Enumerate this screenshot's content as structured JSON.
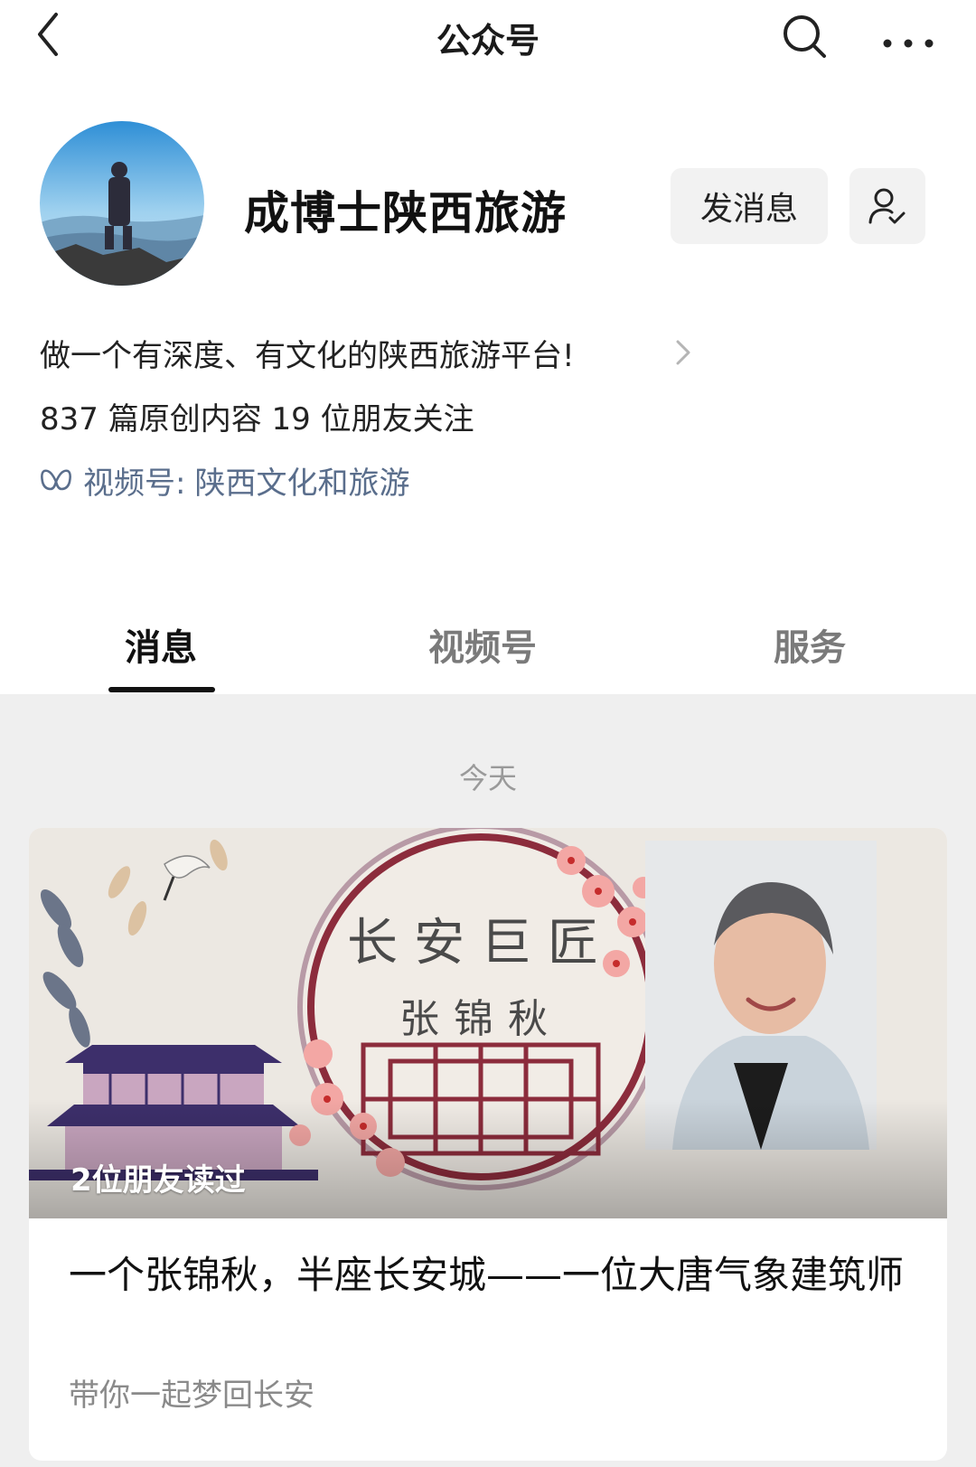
{
  "topbar": {
    "title": "公众号"
  },
  "account": {
    "name": "成博士陕西旅游",
    "message_button": "发消息",
    "description": "做一个有深度、有文化的陕西旅游平台!",
    "stats": "837 篇原创内容  19 位朋友关注",
    "channel_label": "视频号:",
    "channel_name": "陕西文化和旅游"
  },
  "tabs": [
    {
      "label": "消息",
      "active": true
    },
    {
      "label": "视频号",
      "active": false
    },
    {
      "label": "服务",
      "active": false
    }
  ],
  "feed": {
    "date_label": "今天",
    "article": {
      "cover_title": "长安巨匠",
      "cover_name": "张锦秋",
      "read_badge": "2位朋友读过",
      "title": "一个张锦秋，半座长安城——一位大唐气象建筑师",
      "subtitle": "带你一起梦回长安"
    }
  },
  "colors": {
    "accent_link": "#5a6e8c",
    "active_tab": "#111111",
    "inactive_tab": "#7a7a7a",
    "feed_bg": "#efefef"
  },
  "icons": [
    "back-arrow-icon",
    "search-icon",
    "more-icon",
    "follow-user-icon",
    "chevron-right-icon",
    "channels-butterfly-icon"
  ]
}
